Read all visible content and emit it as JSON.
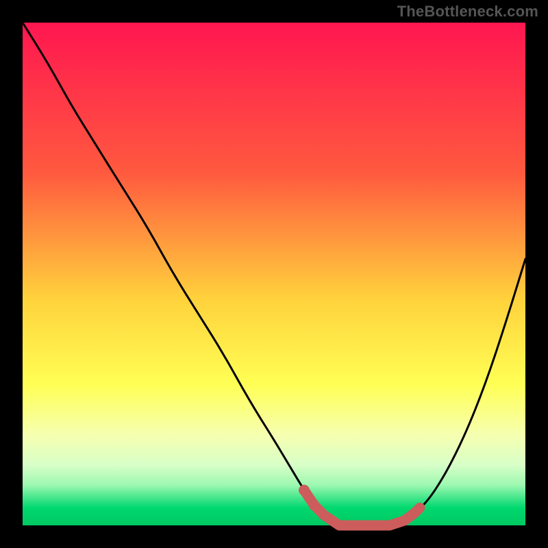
{
  "watermark": "TheBottleneck.com",
  "colors": {
    "frame": "#000000",
    "curve": "#000000",
    "marker": "#CD5C5C",
    "grad_top": "#FF1650",
    "grad_mid1": "#FF7E3C",
    "grad_mid2": "#FFD23C",
    "grad_mid3": "#FFFF66",
    "grad_mid4": "#EFFFB2",
    "grad_bot": "#00D86F"
  },
  "chart_data": {
    "type": "line",
    "title": "",
    "xlabel": "",
    "ylabel": "",
    "xlim": [
      0,
      100
    ],
    "ylim": [
      0,
      100
    ],
    "grid": false,
    "legend": false,
    "series": [
      {
        "name": "bottleneck-curve",
        "x": [
          0,
          5,
          10,
          15,
          20,
          25,
          30,
          35,
          40,
          45,
          50,
          53,
          56,
          58,
          60,
          63,
          66,
          70,
          73,
          76,
          80,
          84,
          88,
          92,
          96,
          100
        ],
        "y": [
          100,
          92,
          83,
          75,
          67,
          59,
          50,
          42,
          34,
          25,
          17,
          12,
          7,
          4,
          2,
          0,
          0,
          0,
          0,
          1,
          4,
          10,
          18,
          28,
          40,
          53
        ]
      }
    ],
    "markers": {
      "name": "optimal-band-markers",
      "color": "#CD5C5C",
      "points": [
        {
          "x": 56,
          "y": 7
        },
        {
          "x": 58,
          "y": 4
        },
        {
          "x": 60,
          "y": 2
        },
        {
          "x": 63,
          "y": 0
        },
        {
          "x": 66,
          "y": 0
        },
        {
          "x": 70,
          "y": 0
        },
        {
          "x": 73,
          "y": 0
        },
        {
          "x": 76,
          "y": 1
        },
        {
          "x": 78,
          "y": 2.5
        },
        {
          "x": 79,
          "y": 3.5
        }
      ]
    }
  }
}
